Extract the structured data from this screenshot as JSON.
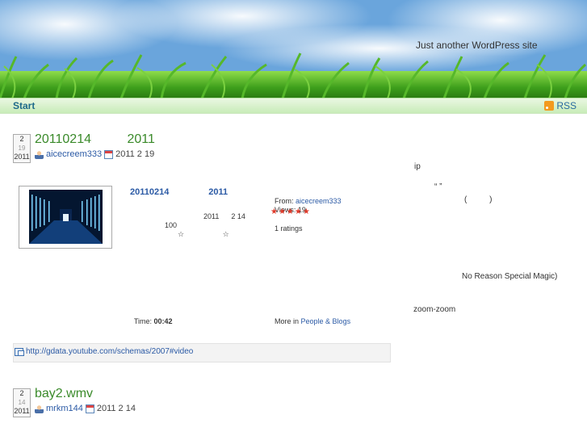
{
  "site": {
    "tagline": "Just another WordPress site"
  },
  "nav": {
    "start_label": "Start",
    "rss_label": "RSS"
  },
  "posts": [
    {
      "date": {
        "month": "2",
        "day": "19",
        "year": "2011"
      },
      "title": "20110214          2011",
      "author": "aicecreem333",
      "date_text": "2011 2 19"
    },
    {
      "date": {
        "month": "2",
        "day": "14",
        "year": "2011"
      },
      "title": "bay2.wmv",
      "author": "mrkm144",
      "date_text": "2011 2 14"
    }
  ],
  "video": {
    "title": "20110214                2011",
    "from_label": "From: ",
    "from_user": "aicecreem333",
    "views_label": "Views: ",
    "views": "19",
    "stars": "★★★★★",
    "ratings_count": "1",
    "ratings_label": " ratings",
    "desc_line1": "2011      2 14",
    "desc_line2": "100",
    "desc_line3": "☆                   ☆",
    "time_label": "Time: ",
    "time_value": "00:42",
    "more_label": "More in ",
    "category": "People & Blogs"
  },
  "side": {
    "ip": "ip",
    "quote": "“ ”",
    "paren": "(          )",
    "magic": "No Reason Special Magic)",
    "zoom": "zoom-zoom"
  },
  "link": {
    "url": "http://gdata.youtube.com/schemas/2007#video"
  },
  "icons": {
    "user": "user-icon",
    "calendar": "calendar-icon",
    "rss": "rss-icon",
    "link": "link-icon"
  }
}
